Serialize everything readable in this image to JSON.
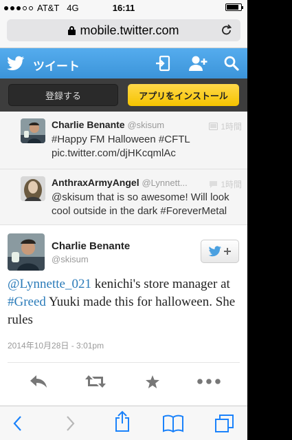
{
  "status_bar": {
    "carrier": "AT&T",
    "network": "4G",
    "time": "16:11",
    "battery_level": 0.85
  },
  "browser": {
    "url": "mobile.twitter.com"
  },
  "twitter_header": {
    "title": "ツイート"
  },
  "install_bar": {
    "register_label": "登録する",
    "install_label": "アプリをインストール"
  },
  "replies": [
    {
      "name": "Charlie Benante",
      "handle": "@skisum",
      "time": "1時間",
      "icon": "photo-icon",
      "text": "#Happy FM Halloween #CFTL pic.twitter.com/djHKcqmlAc"
    },
    {
      "name": "AnthraxArmyAngel",
      "handle": "@Lynnett...",
      "time": "1時間",
      "icon": "reply-bubble-icon",
      "text": "@skisum that is so awesome! Will look cool outside in the dark #ForeverMetal"
    }
  ],
  "main_tweet": {
    "name": "Charlie Benante",
    "handle": "@skisum",
    "mention": "@Lynnette_021",
    "text_1": " kenichi's store manager at ",
    "hashtag": "#Greed",
    "text_2": " Yuuki made this for halloween. She rules",
    "date": "2014年10月28日 - 3:01pm"
  },
  "colors": {
    "twitter_blue": "#55acee",
    "install_yellow": "#f5c400",
    "link_blue": "#2b7bb9",
    "safari_blue": "#1a82fb"
  }
}
